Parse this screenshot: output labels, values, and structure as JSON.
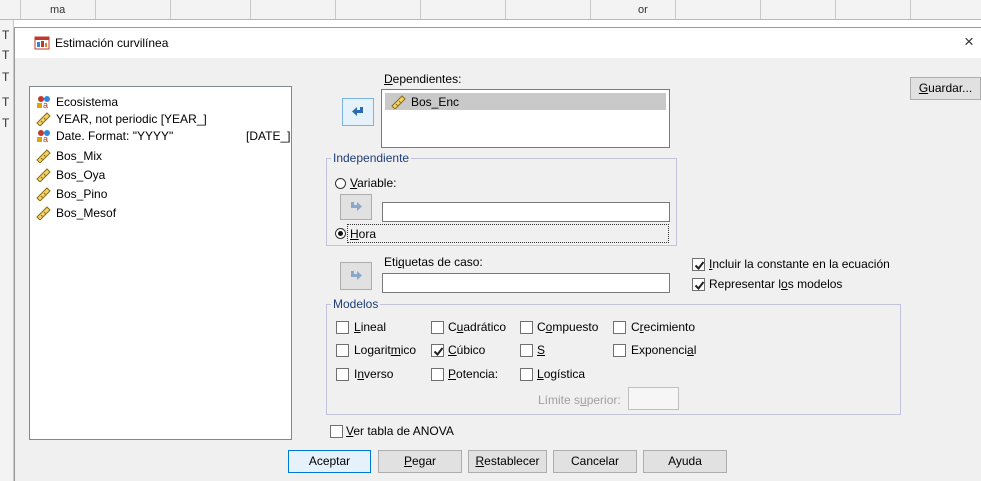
{
  "background": {
    "top_row_text": [
      "ma",
      "or"
    ],
    "left_strip_letters": [
      "T",
      "T",
      "T",
      "T",
      "T"
    ]
  },
  "dialog": {
    "title": "Estimación curvilínea",
    "close_glyph": "×"
  },
  "variables": [
    {
      "label": "Ecosistema",
      "icon": "nominal-icon"
    },
    {
      "label": "YEAR, not periodic [YEAR_]",
      "icon": "scale-icon"
    },
    {
      "label": "Date.  Format: \"YYYY\"",
      "suffix": "[DATE_]",
      "icon": "nominal-icon"
    },
    {
      "label": "Bos_Mix",
      "icon": "scale-icon"
    },
    {
      "label": "Bos_Oya",
      "icon": "scale-icon"
    },
    {
      "label": "Bos_Pino",
      "icon": "scale-icon"
    },
    {
      "label": "Bos_Mesof",
      "icon": "scale-icon"
    }
  ],
  "dependents": {
    "label_pre": "",
    "label_ul": "D",
    "label_post": "ependientes:",
    "items": [
      "Bos_Enc"
    ]
  },
  "independent": {
    "group_title": "Independiente",
    "variable_pre": "",
    "variable_ul": "V",
    "variable_post": "ariable:",
    "variable_value": "",
    "hora_pre": "",
    "hora_ul": "H",
    "hora_post": "ora",
    "selected": "hora"
  },
  "case_labels": {
    "label_pre": "Eti",
    "label_ul": "q",
    "label_post": "uetas de caso:",
    "value": ""
  },
  "options": {
    "include_constant": {
      "pre": "",
      "ul": "I",
      "post": "ncluir la constante en la ecuación",
      "checked": true
    },
    "plot_models": {
      "pre": "Representar l",
      "ul": "o",
      "post": "s modelos",
      "checked": true
    }
  },
  "models": {
    "group_title": "Modelos",
    "items": [
      {
        "pre": "",
        "ul": "L",
        "post": "ineal",
        "checked": false
      },
      {
        "pre": "C",
        "ul": "u",
        "post": "adrático",
        "checked": false
      },
      {
        "pre": "C",
        "ul": "o",
        "post": "mpuesto",
        "checked": false
      },
      {
        "pre": "C",
        "ul": "r",
        "post": "ecimiento",
        "checked": false
      },
      {
        "pre": "Logarit",
        "ul": "m",
        "post": "ico",
        "checked": false
      },
      {
        "pre": "",
        "ul": "C",
        "post": "úbico",
        "checked": true
      },
      {
        "pre": "",
        "ul": "S",
        "post": "",
        "checked": false
      },
      {
        "pre": "Exponenci",
        "ul": "a",
        "post": "l",
        "checked": false
      },
      {
        "pre": "I",
        "ul": "n",
        "post": "verso",
        "checked": false
      },
      {
        "pre": "",
        "ul": "P",
        "post": "otencia:",
        "checked": false
      },
      {
        "pre": "",
        "ul": "L",
        "post": "ogística",
        "checked": false
      }
    ],
    "upper_limit": {
      "pre": "Límite s",
      "ul": "u",
      "post": "perior:",
      "value": ""
    }
  },
  "anova": {
    "pre": "",
    "ul": "V",
    "post": "er tabla de ANOVA",
    "checked": false
  },
  "buttons": {
    "save": {
      "pre": "",
      "ul": "G",
      "post": "uardar..."
    },
    "ok": {
      "pre": "Aceptar",
      "ul": "",
      "post": ""
    },
    "paste": {
      "pre": "",
      "ul": "P",
      "post": "egar"
    },
    "reset": {
      "pre": "",
      "ul": "R",
      "post": "establecer"
    },
    "cancel": {
      "pre": "Cancelar",
      "ul": "",
      "post": ""
    },
    "help": {
      "pre": "Ayuda",
      "ul": "",
      "post": ""
    }
  },
  "colors": {
    "accent": "#0078d7",
    "arrow_active": "#2a6bb8",
    "arrow_disabled": "#8aa8cc"
  }
}
